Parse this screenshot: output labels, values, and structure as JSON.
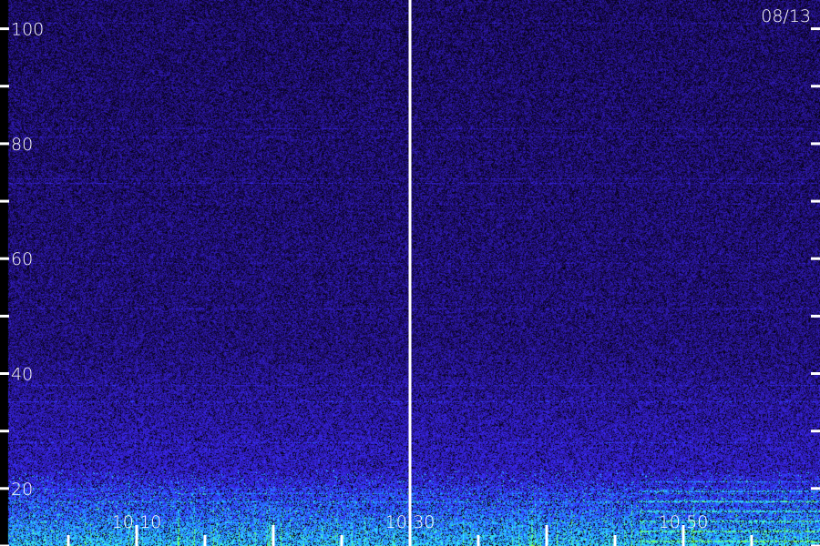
{
  "chart_data": {
    "type": "heatmap",
    "title": "",
    "xlabel": "",
    "ylabel": "",
    "date_label": "08/13",
    "x_range": [
      "10:00",
      "11:00"
    ],
    "x_ticks": [
      {
        "value": "10:10",
        "label": "10:10"
      },
      {
        "value": "10:30",
        "label": "10:30"
      },
      {
        "value": "10:50",
        "label": "10:50"
      }
    ],
    "x_gap_at": "10:30",
    "y_range": [
      10,
      105
    ],
    "y_ticks": [
      {
        "value": 10,
        "label": ""
      },
      {
        "value": 20,
        "label": "20"
      },
      {
        "value": 30,
        "label": ""
      },
      {
        "value": 40,
        "label": "40"
      },
      {
        "value": 50,
        "label": ""
      },
      {
        "value": 60,
        "label": "60"
      },
      {
        "value": 70,
        "label": ""
      },
      {
        "value": 80,
        "label": "80"
      },
      {
        "value": 90,
        "label": ""
      },
      {
        "value": 100,
        "label": "100"
      }
    ],
    "grid": false,
    "legend": "none",
    "colormap": [
      "#000000",
      "#1a0a5c",
      "#2e1ab0",
      "#3a2aff",
      "#1f8fff",
      "#36f0ff",
      "#7dff4a"
    ]
  }
}
